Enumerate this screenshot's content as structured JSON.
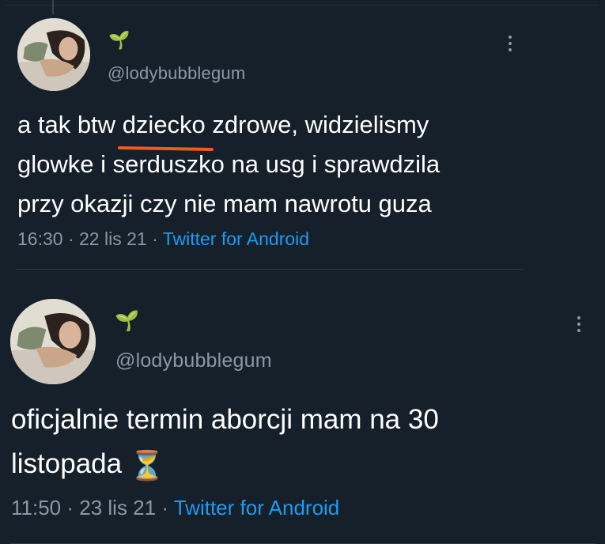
{
  "tweets": [
    {
      "avatar_icon": "profile-photo",
      "name_emoji": "🌱",
      "handle": "@lodybubblegum",
      "text_lines": [
        {
          "before": "a tak btw ",
          "highlight": "dziecko",
          "after": " zdrowe, widzielismy"
        },
        {
          "text": "glowke i serduszko na usg i sprawdzila"
        },
        {
          "text": "przy okazji czy nie mam nawrotu guza"
        }
      ],
      "time": "16:30",
      "date": "22 lis 21",
      "source": "Twitter for Android",
      "highlight_color": "#f05a1e"
    },
    {
      "avatar_icon": "profile-photo",
      "name_emoji": "🌱",
      "handle": "@lodybubblegum",
      "text_lines": [
        {
          "text": "oficjalnie termin aborcji mam na 30"
        },
        {
          "text": "listopada",
          "emoji": "⏳"
        }
      ],
      "time": "11:50",
      "date": "23 lis 21",
      "source": "Twitter for Android"
    }
  ],
  "separator": " · ",
  "colors": {
    "background": "#15202b",
    "text": "#ffffff",
    "secondary": "#8b98a5",
    "link": "#1d9bf0"
  }
}
